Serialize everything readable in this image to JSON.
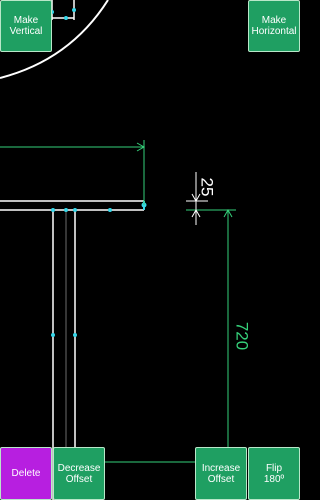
{
  "toolbar": {
    "make_vertical": [
      "Make",
      "Vertical"
    ],
    "make_horizontal": [
      "Make",
      "Horizontal"
    ],
    "delete": "Delete",
    "decrease_offset": [
      "Decrease",
      "Offset"
    ],
    "increase_offset": [
      "Increase",
      "Offset"
    ],
    "flip": [
      "Flip",
      "180º"
    ]
  },
  "dimensions": {
    "small": "25",
    "large": "720"
  },
  "colors": {
    "background": "#000000",
    "button_green": "#1f9f62",
    "button_magenta": "#b71fe0",
    "dimension_green": "#35d07a",
    "node_cyan": "#36d6e8",
    "drawing_white": "#ffffff"
  }
}
